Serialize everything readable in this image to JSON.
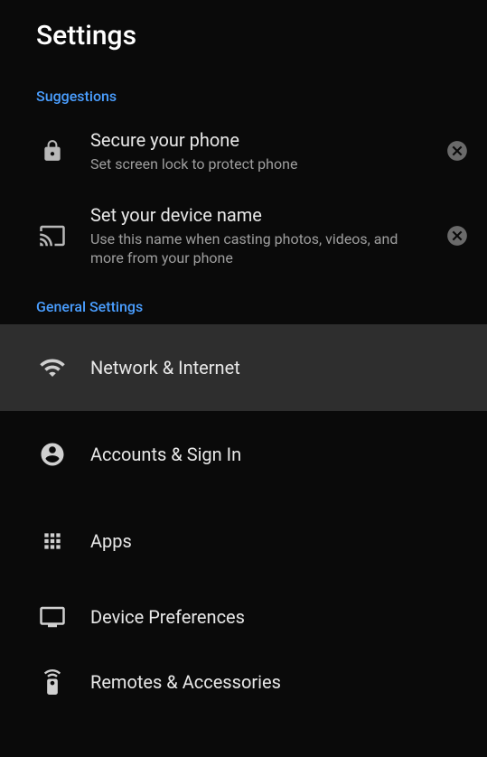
{
  "header": {
    "title": "Settings"
  },
  "sections": {
    "suggestions": {
      "label": "Suggestions",
      "items": [
        {
          "title": "Secure your phone",
          "subtitle": "Set screen lock to protect phone"
        },
        {
          "title": "Set your device name",
          "subtitle": "Use this name when casting photos, videos, and more from your phone"
        }
      ]
    },
    "general": {
      "label": "General Settings",
      "items": [
        {
          "title": "Network & Internet"
        },
        {
          "title": "Accounts & Sign In"
        },
        {
          "title": "Apps"
        },
        {
          "title": "Device Preferences"
        },
        {
          "title": "Remotes & Accessories"
        }
      ]
    }
  }
}
